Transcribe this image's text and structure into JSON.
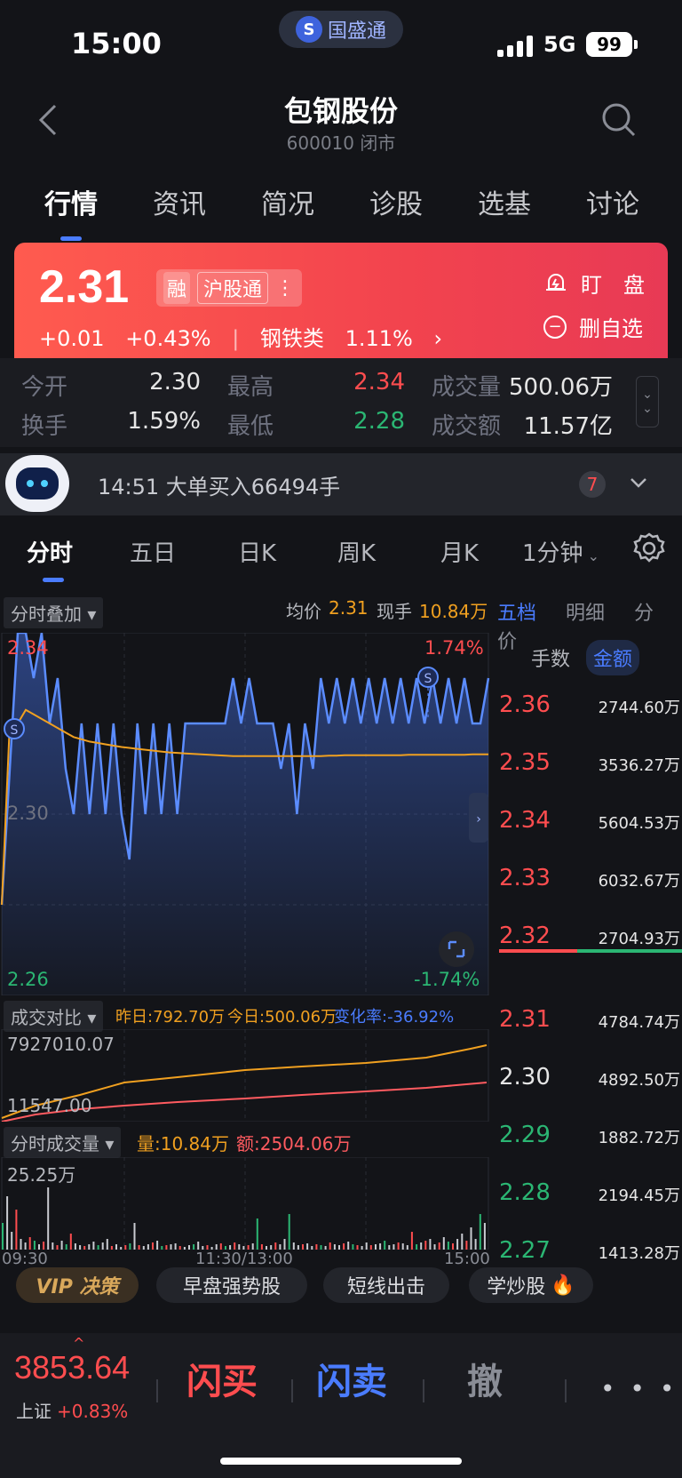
{
  "status_bar": {
    "time": "15:00",
    "app_pill": "国盛通",
    "network": "5G",
    "battery": "99"
  },
  "header": {
    "title": "包钢股份",
    "subtitle": "600010 闭市"
  },
  "top_tabs": [
    "行情",
    "资讯",
    "简况",
    "诊股",
    "选基",
    "讨论"
  ],
  "quote": {
    "price": "2.31",
    "tag_margin": "融",
    "tag_connect": "沪股通",
    "change": "+0.01",
    "change_pct": "+0.43%",
    "sector": "钢铁类",
    "sector_pct": "1.11%",
    "watch": "盯　盘",
    "unfav": "删自选"
  },
  "stats": {
    "open_label": "今开",
    "open": "2.30",
    "high_label": "最高",
    "high": "2.34",
    "vol_label": "成交量",
    "vol": "500.06万",
    "turnover_label": "换手",
    "turnover": "1.59%",
    "low_label": "最低",
    "low": "2.28",
    "amount_label": "成交额",
    "amount": "11.57亿"
  },
  "news": {
    "text": "14:51 大单买入66494手",
    "badge": "7"
  },
  "chart_tabs": [
    "分时",
    "五日",
    "日K",
    "周K",
    "月K",
    "1分钟"
  ],
  "chart_header": {
    "overlay": "分时叠加 ▾",
    "avg_label": "均价",
    "avg": "2.31",
    "cur_label": "现手",
    "cur": "10.84万"
  },
  "chart_labels": {
    "y_top": "2.34",
    "y_mid": "2.30",
    "y_bot": "2.26",
    "pct_top": "1.74%",
    "pct_bot": "-1.74%",
    "s_marker": "S"
  },
  "compare": {
    "chip": "成交对比 ▾",
    "yesterday": "昨日:792.70万",
    "today": "今日:500.06万",
    "rate": "变化率:-36.92%",
    "top": "7927010.07",
    "bot": "11547.00"
  },
  "volume": {
    "chip": "分时成交量 ▾",
    "qty": "量:10.84万",
    "amt": "额:2504.06万",
    "max": "25.25万",
    "t1": "09:30",
    "t2": "11:30/13:00",
    "t3": "15:00"
  },
  "book": {
    "tabs": [
      "五档",
      "明细",
      "分价"
    ],
    "units": [
      "手数",
      "金额"
    ],
    "asks": [
      {
        "p": "2.36",
        "a": "2744.60万"
      },
      {
        "p": "2.35",
        "a": "3536.27万"
      },
      {
        "p": "2.34",
        "a": "5604.53万"
      },
      {
        "p": "2.33",
        "a": "6032.67万"
      },
      {
        "p": "2.32",
        "a": "2704.93万"
      }
    ],
    "bids": [
      {
        "p": "2.31",
        "a": "4784.74万"
      },
      {
        "p": "2.30",
        "a": "4892.50万"
      },
      {
        "p": "2.29",
        "a": "1882.72万"
      },
      {
        "p": "2.28",
        "a": "2194.45万"
      },
      {
        "p": "2.27",
        "a": "1413.28万"
      }
    ]
  },
  "chips": [
    "VIP 决策",
    "早盘强势股",
    "短线出击",
    "学炒股"
  ],
  "bottom": {
    "index_val": "3853.64",
    "index_name": "上证",
    "index_pct": "+0.83%",
    "buy": "闪买",
    "sell": "闪卖",
    "cancel": "撤",
    "more": "• • •"
  },
  "colors": {
    "up": "#ff4d4f",
    "down": "#2bb673",
    "accent": "#4a7cff",
    "avg_line": "#f0a020"
  },
  "chart_data": {
    "type": "line",
    "series": [
      {
        "name": "price",
        "values": [
          2.28,
          2.31,
          2.34,
          2.34,
          2.33,
          2.34,
          2.32,
          2.33,
          2.31,
          2.3,
          2.32,
          2.3,
          2.32,
          2.3,
          2.32,
          2.3,
          2.29,
          2.32,
          2.3,
          2.32,
          2.3,
          2.32,
          2.3,
          2.32,
          2.32,
          2.32,
          2.32,
          2.32,
          2.32,
          2.33,
          2.32,
          2.33,
          2.32,
          2.32,
          2.32,
          2.31,
          2.32,
          2.3,
          2.32,
          2.31,
          2.33,
          2.32,
          2.33,
          2.32,
          2.33,
          2.32,
          2.33,
          2.32,
          2.33,
          2.32,
          2.33,
          2.32,
          2.33,
          2.32,
          2.33,
          2.32,
          2.33,
          2.32,
          2.33,
          2.32,
          2.32,
          2.33
        ]
      },
      {
        "name": "avg",
        "values": [
          2.28,
          2.32,
          2.32,
          2.323,
          2.322,
          2.321,
          2.32,
          2.319,
          2.318,
          2.317,
          2.3165,
          2.316,
          2.3157,
          2.3154,
          2.3151,
          2.3148,
          2.3146,
          2.3144,
          2.3142,
          2.314,
          2.3138,
          2.3136,
          2.3135,
          2.3134,
          2.3133,
          2.3132,
          2.3131,
          2.313,
          2.3129,
          2.3128,
          2.3128,
          2.3128,
          2.3128,
          2.3128,
          2.3128,
          2.3128,
          2.3128,
          2.3128,
          2.3128,
          2.3128,
          2.3128,
          2.3129,
          2.3129,
          2.313,
          2.313,
          2.313,
          2.313,
          2.313,
          2.313,
          2.313,
          2.313,
          2.3131,
          2.3131,
          2.3131,
          2.3131,
          2.3131,
          2.3131,
          2.3131,
          2.3131,
          2.3132,
          2.3132,
          2.3132
        ]
      }
    ],
    "ylim": [
      2.26,
      2.34
    ]
  }
}
